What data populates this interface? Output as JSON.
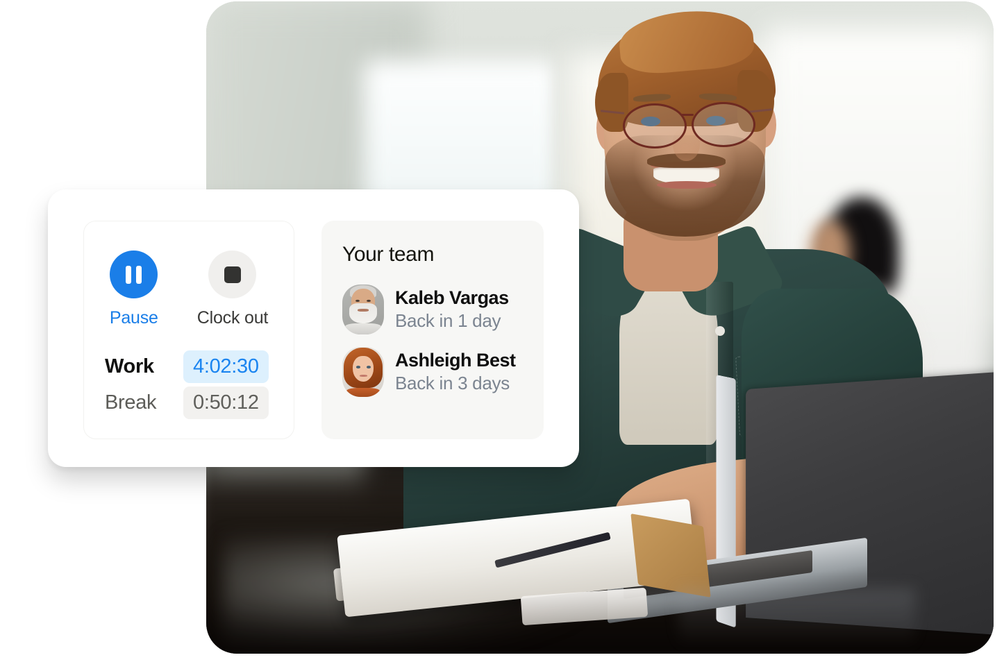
{
  "widget": {
    "timer": {
      "controls": [
        {
          "icon": "pause-icon",
          "label": "Pause"
        },
        {
          "icon": "stop-icon",
          "label": "Clock out"
        }
      ],
      "rows": [
        {
          "label": "Work",
          "value": "4:02:30"
        },
        {
          "label": "Break",
          "value": "0:50:12"
        }
      ]
    },
    "team": {
      "title": "Your team",
      "members": [
        {
          "name": "Kaleb Vargas",
          "status": "Back in 1 day",
          "avatar": "avatar-kaleb-vargas"
        },
        {
          "name": "Ashleigh Best",
          "status": "Back in 3 days",
          "avatar": "avatar-ashleigh-best"
        }
      ]
    }
  },
  "photo": {
    "alt": "Smiling man with glasses working on a laptop in a bright office"
  },
  "colors": {
    "accent_blue": "#1a7ee8",
    "work_chip_bg": "#ddf0fd",
    "work_chip_text": "#1a84f0",
    "break_chip_bg": "#f2f1ef",
    "break_chip_text": "#5f5f5b",
    "stop_circle_bg": "#f0efed",
    "stop_square": "#333331",
    "team_panel_bg": "#f7f7f5",
    "status_text": "#7b8490",
    "card_bg": "#ffffff"
  }
}
